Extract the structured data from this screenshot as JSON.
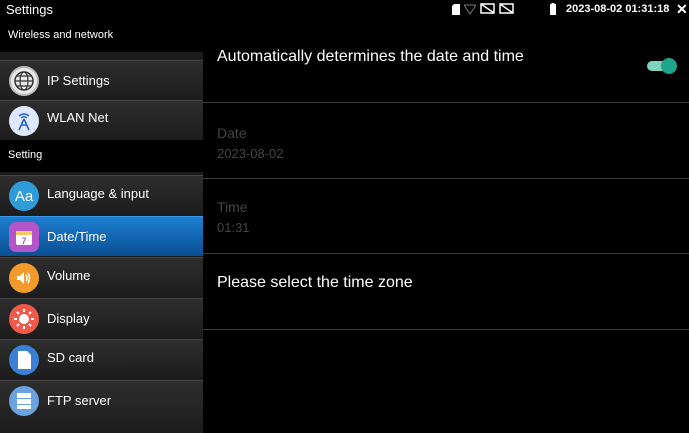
{
  "status_bar": {
    "title": "Settings",
    "clock": "2023-08-02 01:31:18"
  },
  "sidebar": {
    "section_wireless": "Wireless and network",
    "section_setting": "Setting",
    "items": [
      {
        "label": "IP Settings",
        "icon": "globe-icon",
        "color": "#e8e8e8"
      },
      {
        "label": "WLAN Net",
        "icon": "wifi-antenna-icon",
        "color": "#dfe8ff"
      },
      {
        "label": "Language & input",
        "icon": "language-icon",
        "color": "#2f9bd8"
      },
      {
        "label": "Date/Time",
        "icon": "calendar-icon",
        "color": "#b455c8",
        "active": true
      },
      {
        "label": "Volume",
        "icon": "speaker-icon",
        "color": "#f29b2b"
      },
      {
        "label": "Display",
        "icon": "brightness-icon",
        "color": "#f05a4b"
      },
      {
        "label": "SD card",
        "icon": "sd-card-icon",
        "color": "#3a80d4"
      },
      {
        "label": "FTP server",
        "icon": "ftp-server-icon",
        "color": "#6aa3e0"
      }
    ]
  },
  "main": {
    "auto_time_label": "Automatically determines the date and time",
    "auto_time_enabled": true,
    "date_label": "Date",
    "date_value": "2023-08-02",
    "time_label": "Time",
    "time_value": "01:31",
    "timezone_label": "Please select the time zone"
  },
  "colors": {
    "accent": "#1d7fd1",
    "toggle_on": "#1fa58a"
  }
}
